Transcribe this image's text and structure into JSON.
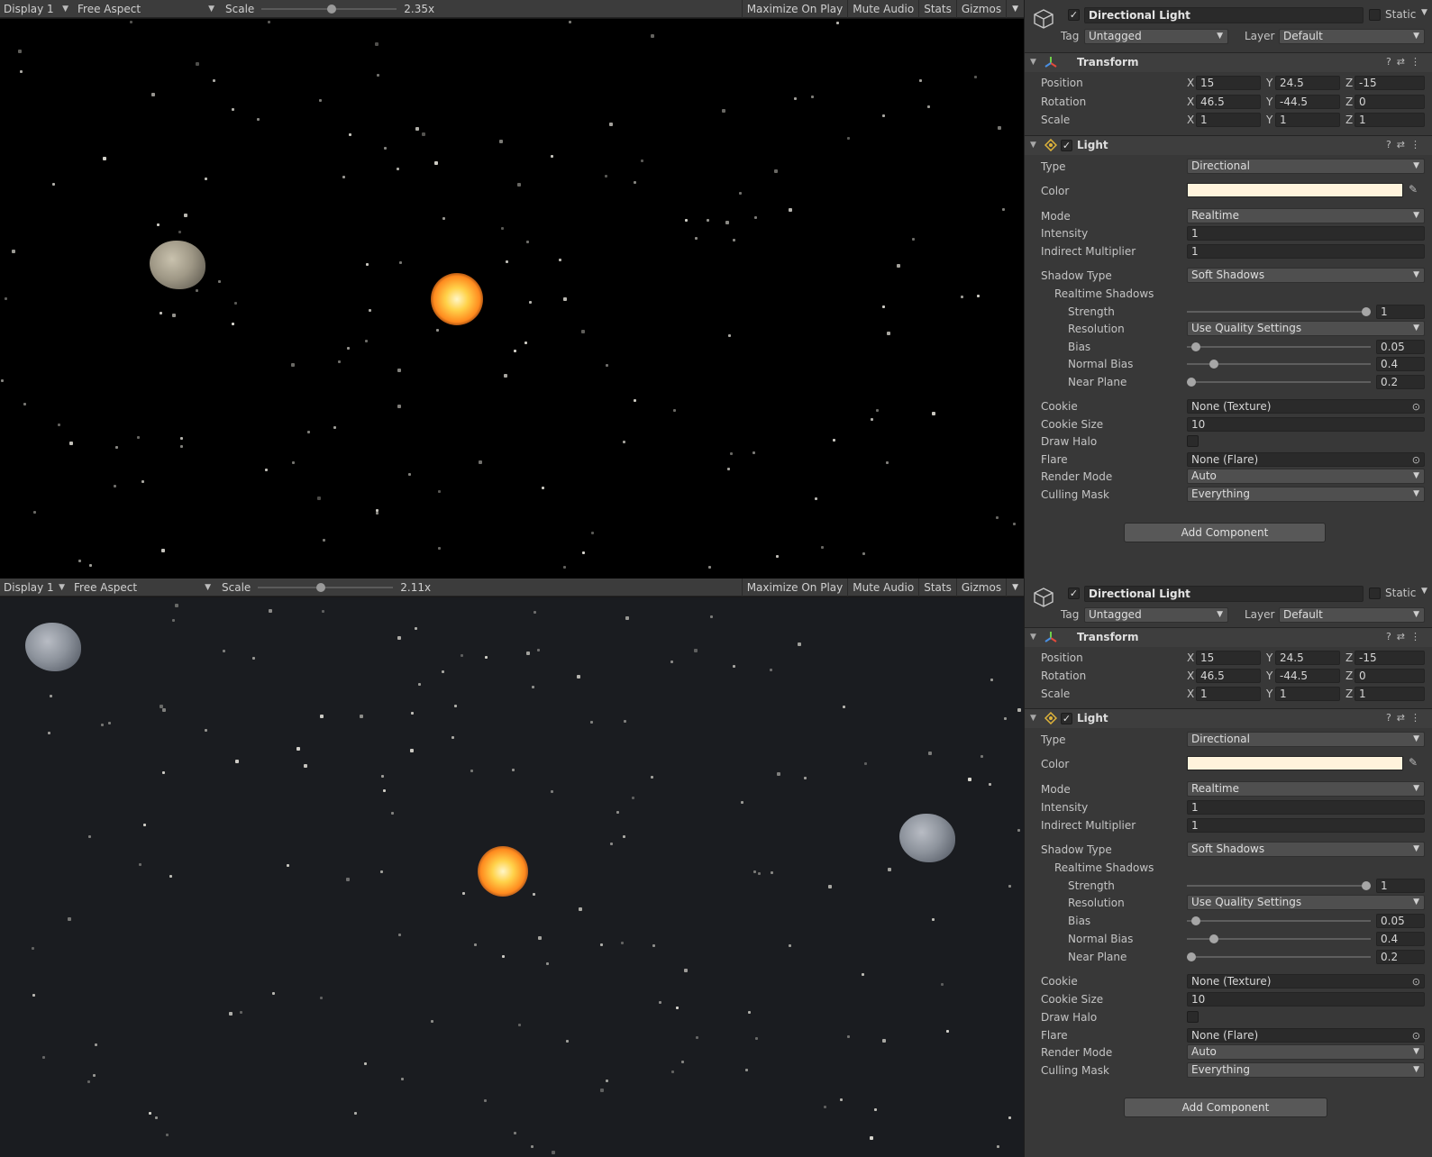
{
  "panes": [
    {
      "toolbar": {
        "display": "Display 1",
        "aspect": "Free Aspect",
        "scale_label": "Scale",
        "scale_value": "2.35x",
        "scale_fraction": 0.52,
        "buttons": [
          "Maximize On Play",
          "Mute Audio",
          "Stats",
          "Gizmos"
        ]
      },
      "inspector": {
        "object_name": "Directional Light",
        "static_label": "Static",
        "tag_label": "Tag",
        "tag_value": "Untagged",
        "layer_label": "Layer",
        "layer_value": "Default",
        "transform": {
          "title": "Transform",
          "position": {
            "label": "Position",
            "x": "15",
            "y": "24.5",
            "z": "-15"
          },
          "rotation": {
            "label": "Rotation",
            "x": "46.5",
            "y": "-44.5",
            "z": "0"
          },
          "scale": {
            "label": "Scale",
            "x": "1",
            "y": "1",
            "z": "1"
          }
        },
        "light": {
          "title": "Light",
          "type_label": "Type",
          "type_value": "Directional",
          "color_label": "Color",
          "color_value": "#fff3dc",
          "mode_label": "Mode",
          "mode_value": "Realtime",
          "intensity_label": "Intensity",
          "intensity_value": "1",
          "indirect_label": "Indirect Multiplier",
          "indirect_value": "1",
          "shadow_type_label": "Shadow Type",
          "shadow_type_value": "Soft Shadows",
          "realtime_shadows_label": "Realtime Shadows",
          "strength_label": "Strength",
          "strength_value": "1",
          "strength_fraction": 1.0,
          "resolution_label": "Resolution",
          "resolution_value": "Use Quality Settings",
          "bias_label": "Bias",
          "bias_value": "0.05",
          "bias_fraction": 0.025,
          "normal_bias_label": "Normal Bias",
          "normal_bias_value": "0.4",
          "normal_bias_fraction": 0.13,
          "near_plane_label": "Near Plane",
          "near_plane_value": "0.2",
          "near_plane_fraction": 0.0,
          "cookie_label": "Cookie",
          "cookie_value": "None (Texture)",
          "cookie_size_label": "Cookie Size",
          "cookie_size_value": "10",
          "draw_halo_label": "Draw Halo",
          "flare_label": "Flare",
          "flare_value": "None (Flare)",
          "render_mode_label": "Render Mode",
          "render_mode_value": "Auto",
          "culling_mask_label": "Culling Mask",
          "culling_mask_value": "Everything"
        },
        "add_component": "Add Component"
      }
    },
    {
      "toolbar": {
        "display": "Display 1",
        "aspect": "Free Aspect",
        "scale_label": "Scale",
        "scale_value": "2.11x",
        "scale_fraction": 0.46,
        "buttons": [
          "Maximize On Play",
          "Mute Audio",
          "Stats",
          "Gizmos"
        ]
      },
      "inspector": {
        "object_name": "Directional Light",
        "static_label": "Static",
        "tag_label": "Tag",
        "tag_value": "Untagged",
        "layer_label": "Layer",
        "layer_value": "Default",
        "transform": {
          "title": "Transform",
          "position": {
            "label": "Position",
            "x": "15",
            "y": "24.5",
            "z": "-15"
          },
          "rotation": {
            "label": "Rotation",
            "x": "46.5",
            "y": "-44.5",
            "z": "0"
          },
          "scale": {
            "label": "Scale",
            "x": "1",
            "y": "1",
            "z": "1"
          }
        },
        "light": {
          "title": "Light",
          "type_label": "Type",
          "type_value": "Directional",
          "color_label": "Color",
          "color_value": "#fff3dc",
          "mode_label": "Mode",
          "mode_value": "Realtime",
          "intensity_label": "Intensity",
          "intensity_value": "1",
          "indirect_label": "Indirect Multiplier",
          "indirect_value": "1",
          "shadow_type_label": "Shadow Type",
          "shadow_type_value": "Soft Shadows",
          "realtime_shadows_label": "Realtime Shadows",
          "strength_label": "Strength",
          "strength_value": "1",
          "strength_fraction": 1.0,
          "resolution_label": "Resolution",
          "resolution_value": "Use Quality Settings",
          "bias_label": "Bias",
          "bias_value": "0.05",
          "bias_fraction": 0.025,
          "normal_bias_label": "Normal Bias",
          "normal_bias_value": "0.4",
          "normal_bias_fraction": 0.13,
          "near_plane_label": "Near Plane",
          "near_plane_value": "0.2",
          "near_plane_fraction": 0.0,
          "cookie_label": "Cookie",
          "cookie_value": "None (Texture)",
          "cookie_size_label": "Cookie Size",
          "cookie_size_value": "10",
          "draw_halo_label": "Draw Halo",
          "flare_label": "Flare",
          "flare_value": "None (Flare)",
          "render_mode_label": "Render Mode",
          "render_mode_value": "Auto",
          "culling_mask_label": "Culling Mask",
          "culling_mask_value": "Everything"
        },
        "add_component": "Add Component"
      }
    }
  ]
}
